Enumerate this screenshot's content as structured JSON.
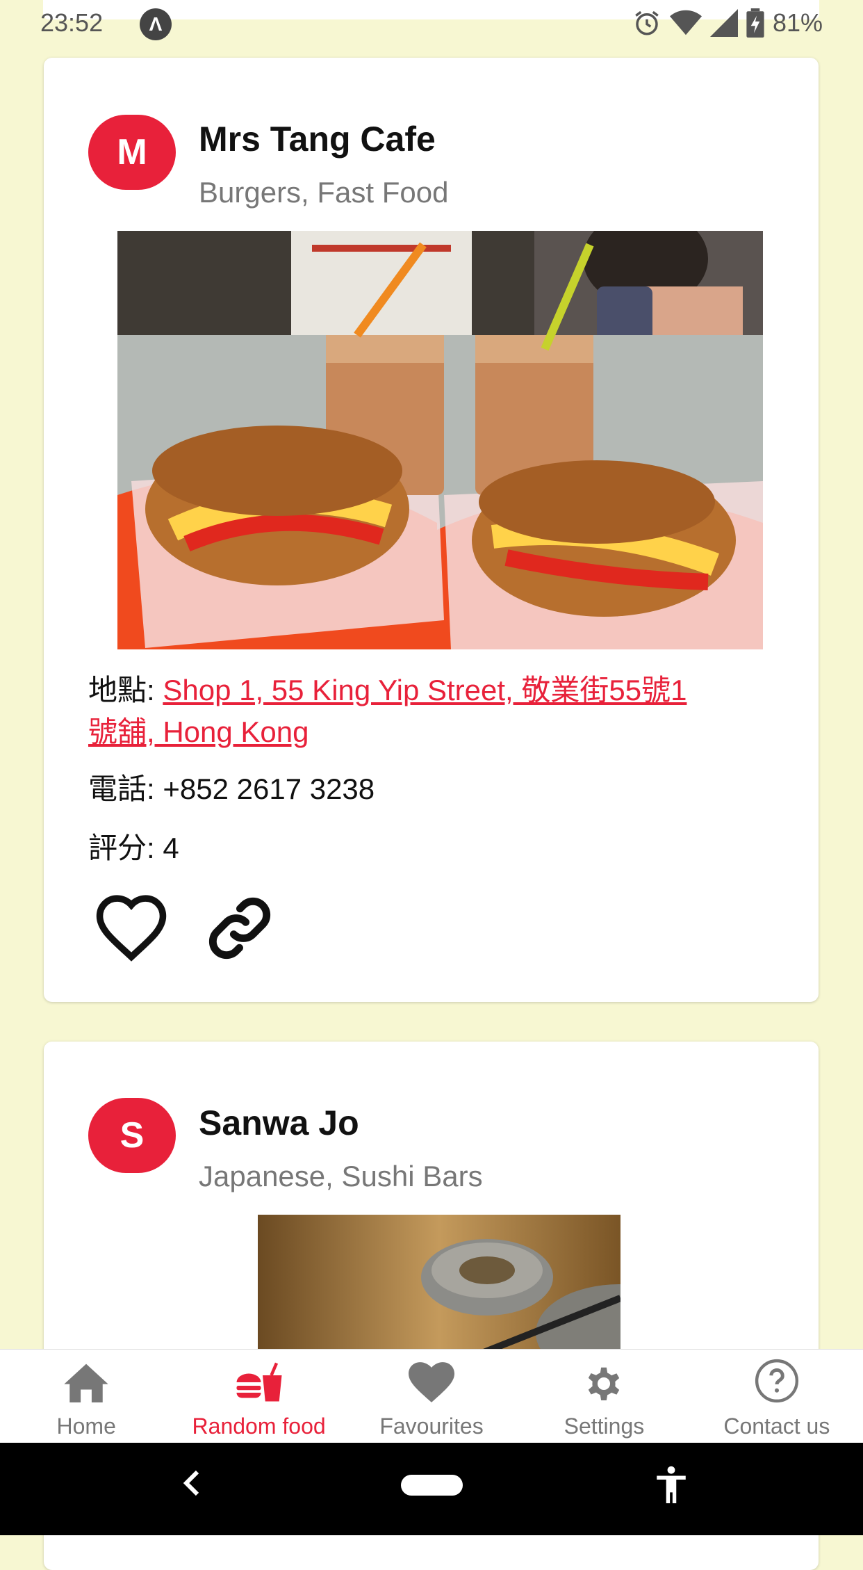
{
  "status_bar": {
    "time": "23:52",
    "notification_glyph": "Λ",
    "battery": "81%",
    "icons": [
      "alarm-icon",
      "wifi-icon",
      "signal-icon",
      "battery-icon"
    ]
  },
  "cards": [
    {
      "avatar_letter": "M",
      "name": "Mrs Tang Cafe",
      "categories": "Burgers, Fast Food",
      "address_label": "地點: ",
      "address_line1": "Shop 1, 55 King Yip Street, 敬業街55號1",
      "address_line2": "號舖, Hong Kong",
      "phone_label": "電話: ",
      "phone": "+852 2617 3238",
      "rating_label": "評分: ",
      "rating": "4"
    },
    {
      "avatar_letter": "S",
      "name": "Sanwa Jo",
      "categories": "Japanese, Sushi Bars"
    }
  ],
  "bottom_nav": [
    {
      "label": "Home",
      "icon": "home-icon"
    },
    {
      "label": "Random food",
      "icon": "food-icon",
      "active": true
    },
    {
      "label": "Favourites",
      "icon": "heart-icon"
    },
    {
      "label": "Settings",
      "icon": "gear-icon"
    },
    {
      "label": "Contact us",
      "icon": "help-icon"
    }
  ],
  "colors": {
    "accent": "#e8213a",
    "background": "#f7f7d2",
    "nav_inactive": "#777777"
  }
}
